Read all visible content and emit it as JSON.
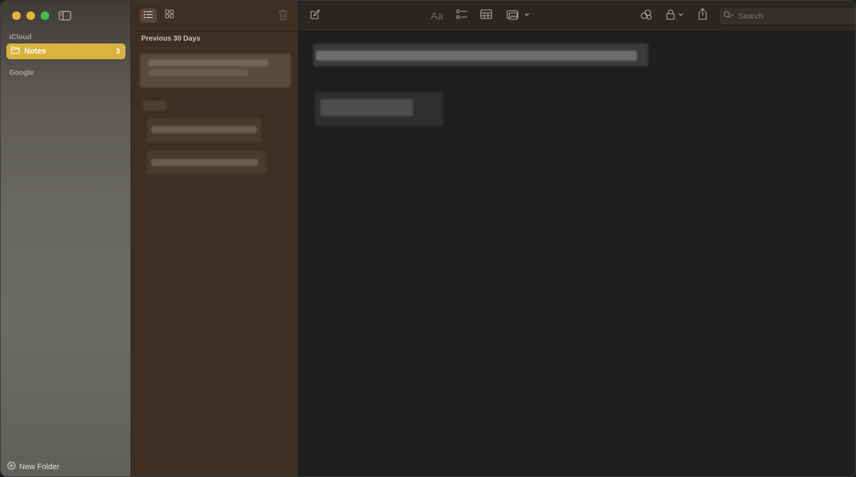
{
  "sidebar": {
    "sections": [
      {
        "label": "iCloud"
      },
      {
        "label": "Google"
      }
    ],
    "folders": [
      {
        "label": "Notes",
        "count": "3",
        "selected": true
      }
    ],
    "new_folder_label": "New Folder",
    "icons": [
      "sidebar-toggle-icon",
      "folder-icon",
      "plus-circle-icon"
    ]
  },
  "notelist": {
    "header": "Previous 30 Days",
    "view_modes": [
      "list",
      "gallery"
    ],
    "active_view": "list"
  },
  "editor": {
    "toolbar": {
      "format_label": "Aa",
      "search_placeholder": "Search"
    }
  },
  "colors": {
    "accent": "#d9b33e",
    "sidebar_bg": "#6a6864",
    "notelist_bg": "#3d2f21",
    "editor_bg": "#1f1f1f"
  }
}
